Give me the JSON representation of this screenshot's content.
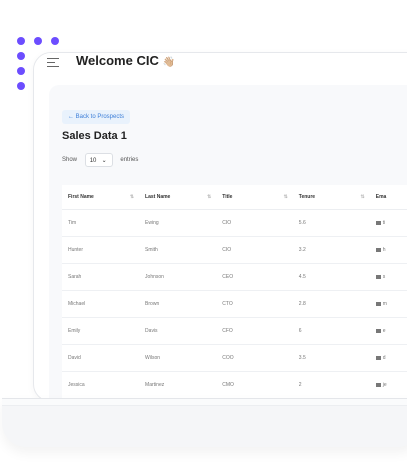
{
  "header": {
    "title": "Welcome CIC",
    "emoji": "👋🏼"
  },
  "back_button": {
    "label": "Back to Prospects"
  },
  "page": {
    "title": "Sales Data 1"
  },
  "entries": {
    "show_label": "Show",
    "value": "10",
    "suffix": "entries"
  },
  "table": {
    "columns": [
      "First Name",
      "Last Name",
      "Title",
      "Tenure",
      "Ema"
    ],
    "rows": [
      [
        "Tim",
        "Ewing",
        "CIO",
        "5.6",
        "ti"
      ],
      [
        "Hunter",
        "Smith",
        "CIO",
        "3.2",
        "h"
      ],
      [
        "Sarah",
        "Johnson",
        "CEO",
        "4.5",
        "s"
      ],
      [
        "Michael",
        "Brown",
        "CTO",
        "2.8",
        "m"
      ],
      [
        "Emily",
        "Davis",
        "CFO",
        "6",
        "e"
      ],
      [
        "David",
        "Wilson",
        "COO",
        "3.5",
        "d"
      ],
      [
        "Jessica",
        "Martinez",
        "CMO",
        "2",
        "je"
      ]
    ]
  },
  "colors": {
    "accent_purple": "#6c4dff",
    "back_button_bg": "#e9f2fc",
    "back_button_text": "#3b7dd8"
  }
}
